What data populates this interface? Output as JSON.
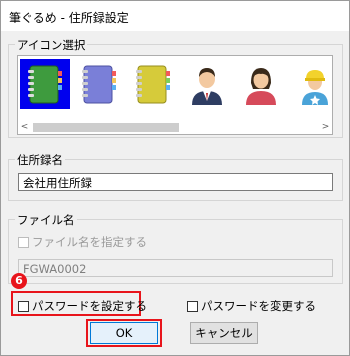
{
  "window": {
    "title": "筆ぐるめ - 住所録設定"
  },
  "icon_select": {
    "label": "アイコン選択",
    "icons": [
      {
        "name": "green-notebook-icon",
        "color": "#3e9b3e",
        "selected": true
      },
      {
        "name": "blue-notebook-icon",
        "color": "#7a7fd8",
        "selected": false
      },
      {
        "name": "yellow-notebook-icon",
        "color": "#d6cb3a",
        "selected": false
      },
      {
        "name": "man-avatar-icon",
        "selected": false
      },
      {
        "name": "woman-avatar-icon",
        "selected": false
      },
      {
        "name": "worker-avatar-icon",
        "selected": false
      }
    ],
    "scroll_left": "<",
    "scroll_right": ">"
  },
  "address_book_name": {
    "label": "住所録名",
    "value": "会社用住所録"
  },
  "file_name": {
    "label": "ファイル名",
    "specify_label": "ファイル名を指定する",
    "value": "FGWA0002"
  },
  "password": {
    "set_label": "パスワードを設定する",
    "change_label": "パスワードを変更する",
    "step_badge": "6"
  },
  "buttons": {
    "ok": "OK",
    "cancel": "キャンセル"
  },
  "colors": {
    "highlight": "#e8141b",
    "selected_icon_bg": "#0000ee"
  }
}
